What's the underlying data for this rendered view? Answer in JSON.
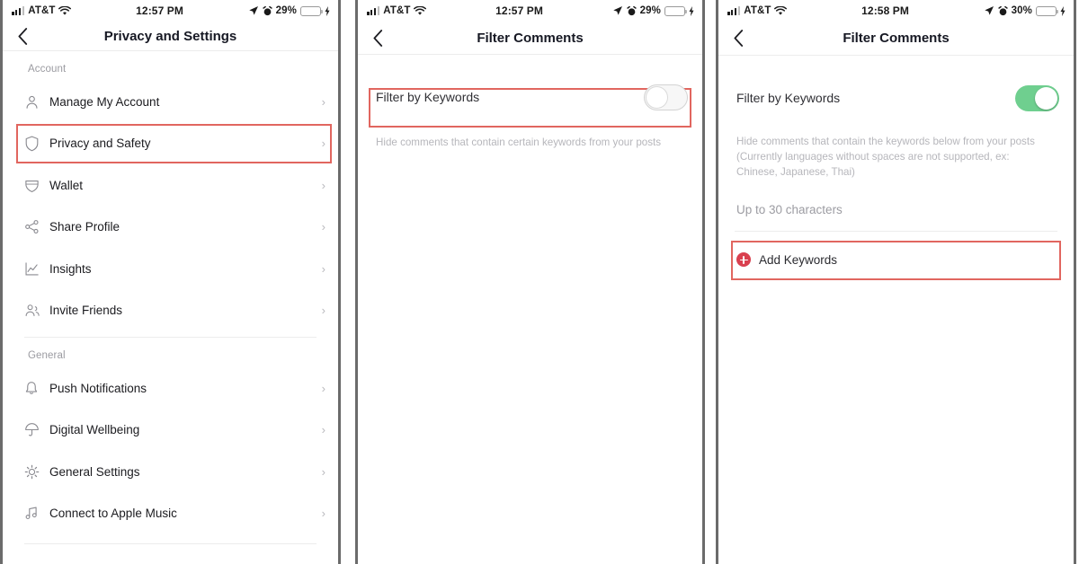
{
  "panels": [
    {
      "id": "privacy-and-settings",
      "status_bar": {
        "carrier": "AT&T",
        "time": "12:57 PM",
        "battery_percent": "29%",
        "icons": [
          "signal-bars-icon",
          "wifi-icon",
          "location-arrow-icon",
          "alarm-clock-icon",
          "battery-icon",
          "charging-bolt-icon"
        ]
      },
      "nav": {
        "back_icon": "chevron-left-icon",
        "title": "Privacy and Settings"
      },
      "sections": [
        {
          "header": "Account",
          "items": [
            {
              "label": "Manage My Account",
              "icon": "person-icon",
              "highlighted": false
            },
            {
              "label": "Privacy and Safety",
              "icon": "shield-icon",
              "highlighted": true
            },
            {
              "label": "Wallet",
              "icon": "wallet-icon",
              "highlighted": false
            },
            {
              "label": "Share Profile",
              "icon": "share-nodes-icon",
              "highlighted": false
            },
            {
              "label": "Insights",
              "icon": "line-chart-icon",
              "highlighted": false
            },
            {
              "label": "Invite Friends",
              "icon": "people-icon",
              "highlighted": false
            }
          ]
        },
        {
          "header": "General",
          "items": [
            {
              "label": "Push Notifications",
              "icon": "bell-icon",
              "highlighted": false
            },
            {
              "label": "Digital Wellbeing",
              "icon": "umbrella-icon",
              "highlighted": false
            },
            {
              "label": "General Settings",
              "icon": "gear-icon",
              "highlighted": false
            },
            {
              "label": "Connect to Apple Music",
              "icon": "music-note-icon",
              "highlighted": false
            }
          ]
        }
      ]
    },
    {
      "id": "filter-comments-off",
      "status_bar": {
        "carrier": "AT&T",
        "time": "12:57 PM",
        "battery_percent": "29%"
      },
      "nav": {
        "back_icon": "chevron-left-icon",
        "title": "Filter Comments"
      },
      "toggle": {
        "label": "Filter by Keywords",
        "state": "off",
        "highlighted": true
      },
      "helper_text": "Hide comments that contain certain keywords from your posts"
    },
    {
      "id": "filter-comments-on",
      "status_bar": {
        "carrier": "AT&T",
        "time": "12:58 PM",
        "battery_percent": "30%"
      },
      "nav": {
        "back_icon": "chevron-left-icon",
        "title": "Filter Comments"
      },
      "toggle": {
        "label": "Filter by Keywords",
        "state": "on",
        "highlighted": false
      },
      "helper_text": "Hide comments that contain the keywords below from your posts (Currently languages without spaces are not supported, ex: Chinese, Japanese, Thai)",
      "char_limit_label": "Up to 30 characters",
      "add_keywords": {
        "label": "Add Keywords",
        "icon": "plus-circle-icon",
        "highlighted": true
      }
    }
  ],
  "colors": {
    "highlight_border": "#e1665f",
    "toggle_on": "#6fcf8f",
    "plus_red": "#d9404f",
    "battery_yellow": "#f5c518"
  }
}
